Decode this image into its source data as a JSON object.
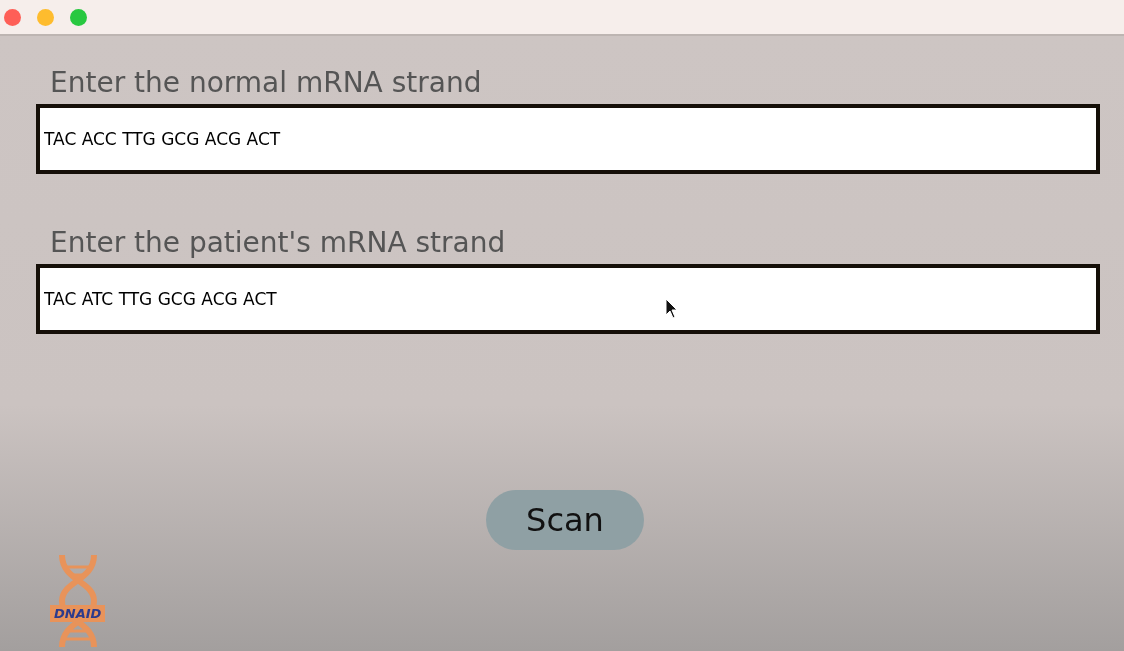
{
  "fields": [
    {
      "label": "Enter the normal mRNA strand",
      "value": "TAC ACC TTG GCG ACG ACT"
    },
    {
      "label": "Enter the patient's mRNA strand",
      "value": "TAC ATC TTG GCG ACG ACT"
    }
  ],
  "button": "Scan",
  "logo": {
    "text": "DNAID"
  }
}
